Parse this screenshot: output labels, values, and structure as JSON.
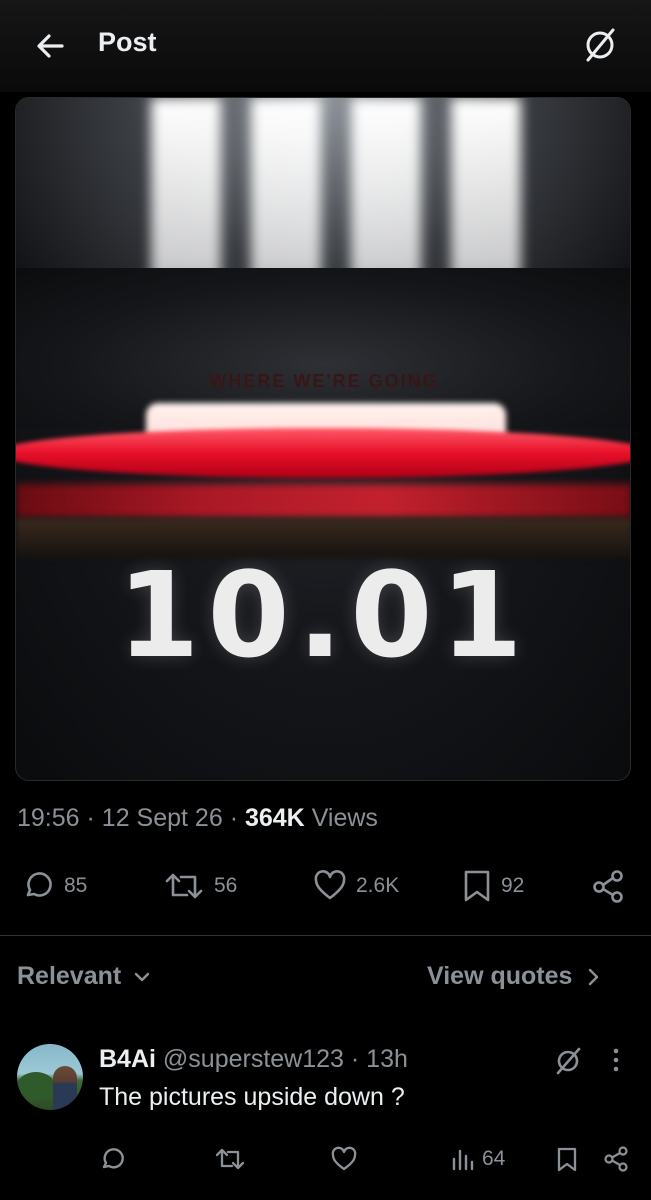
{
  "header": {
    "title": "Post",
    "back_icon": "arrow-left-icon",
    "grok_icon": "grok-icon"
  },
  "media": {
    "tagline": "WHERE WE'RE GOING",
    "date_text": "10.01"
  },
  "post_meta": {
    "time": "19:56",
    "separator": "·",
    "date": "12 Sept 26",
    "views_count": "364K",
    "views_label": "Views"
  },
  "actions": {
    "replies": "85",
    "reposts": "56",
    "likes": "2.6K",
    "bookmarks": "92"
  },
  "replies_bar": {
    "sort_label": "Relevant",
    "view_quotes_label": "View quotes"
  },
  "reply": {
    "name": "B4Ai",
    "handle": "@superstew123",
    "time": "· 13h",
    "text": "The pictures upside down ?",
    "views": "64"
  },
  "colors": {
    "muted": "#8b9197",
    "text": "#eceff1",
    "background": "#000000",
    "accent_red": "#e8102a"
  }
}
